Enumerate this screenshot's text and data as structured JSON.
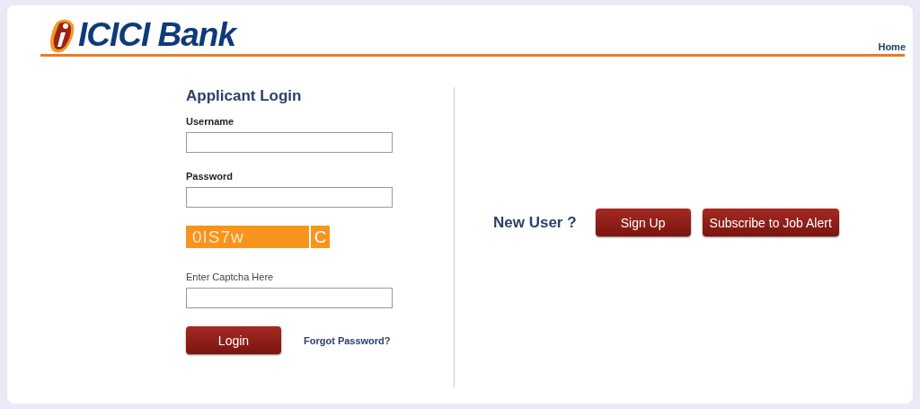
{
  "header": {
    "logo_text": "ICICI Bank",
    "nav": [
      {
        "label": "Home"
      }
    ]
  },
  "login": {
    "title": "Applicant Login",
    "fields": [
      {
        "label": "Username"
      },
      {
        "label": "Password"
      }
    ],
    "captcha": {
      "code": "0IS7w",
      "refresh": "C"
    },
    "captcha_field": {
      "label": "Enter Captcha Here"
    },
    "login_button": "Login",
    "forgot_link": "Forgot Password?"
  },
  "new_user": {
    "label": "New User ?",
    "buttons": [
      "Sign Up",
      "Subscribe to Job Alert"
    ]
  }
}
